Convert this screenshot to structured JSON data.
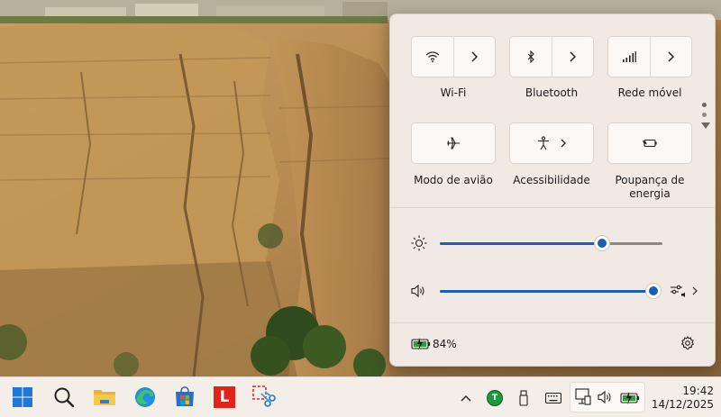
{
  "quick_settings": {
    "tiles": [
      {
        "label": "Wi-Fi",
        "icon": "wifi-icon",
        "expand_icon": "chevron-right-icon"
      },
      {
        "label": "Bluetooth",
        "icon": "bluetooth-icon",
        "expand_icon": "chevron-right-icon"
      },
      {
        "label": "Rede móvel",
        "icon": "cellular-signal-icon",
        "expand_icon": "chevron-right-icon"
      },
      {
        "label": "Modo de avião",
        "icon": "airplane-icon"
      },
      {
        "label": "Acessibilidade",
        "icon": "accessibility-icon",
        "expand_icon": "chevron-right-icon"
      },
      {
        "label": "Poupança de energia",
        "icon": "energy-saver-icon"
      }
    ],
    "brightness": {
      "icon": "brightness-icon",
      "value": 0.73
    },
    "volume": {
      "icon": "speaker-icon",
      "value": 1.0,
      "extra_icon": "audio-output-settings-icon"
    },
    "battery": {
      "icon": "battery-charging-icon",
      "percent_label": "84%"
    },
    "settings_icon": "gear-icon",
    "pager": {
      "pages": 2,
      "current": 1
    }
  },
  "taskbar": {
    "pinned": [
      {
        "name": "start-button",
        "icon": "windows-logo-icon"
      },
      {
        "name": "search-button",
        "icon": "search-icon"
      },
      {
        "name": "file-explorer-button",
        "icon": "folder-icon"
      },
      {
        "name": "edge-button",
        "icon": "edge-browser-icon"
      },
      {
        "name": "store-button",
        "icon": "microsoft-store-icon"
      },
      {
        "name": "app-l-button",
        "icon": "red-l-app-icon",
        "glyph": "L"
      },
      {
        "name": "snipping-tool-button",
        "icon": "snipping-tool-icon"
      }
    ],
    "tray": {
      "overflow_icon": "chevron-up-icon",
      "app_badge_letter": "T",
      "icons": [
        "usb-drive-icon",
        "keyboard-icon",
        "network-icon",
        "volume-icon",
        "battery-charging-icon"
      ]
    },
    "clock": {
      "time": "19:42",
      "date": "14/12/2025"
    }
  },
  "colors": {
    "accent": "#1a5fb4",
    "panel_bg": "#f1e9e4",
    "battery_green": "#2e9d3a"
  }
}
